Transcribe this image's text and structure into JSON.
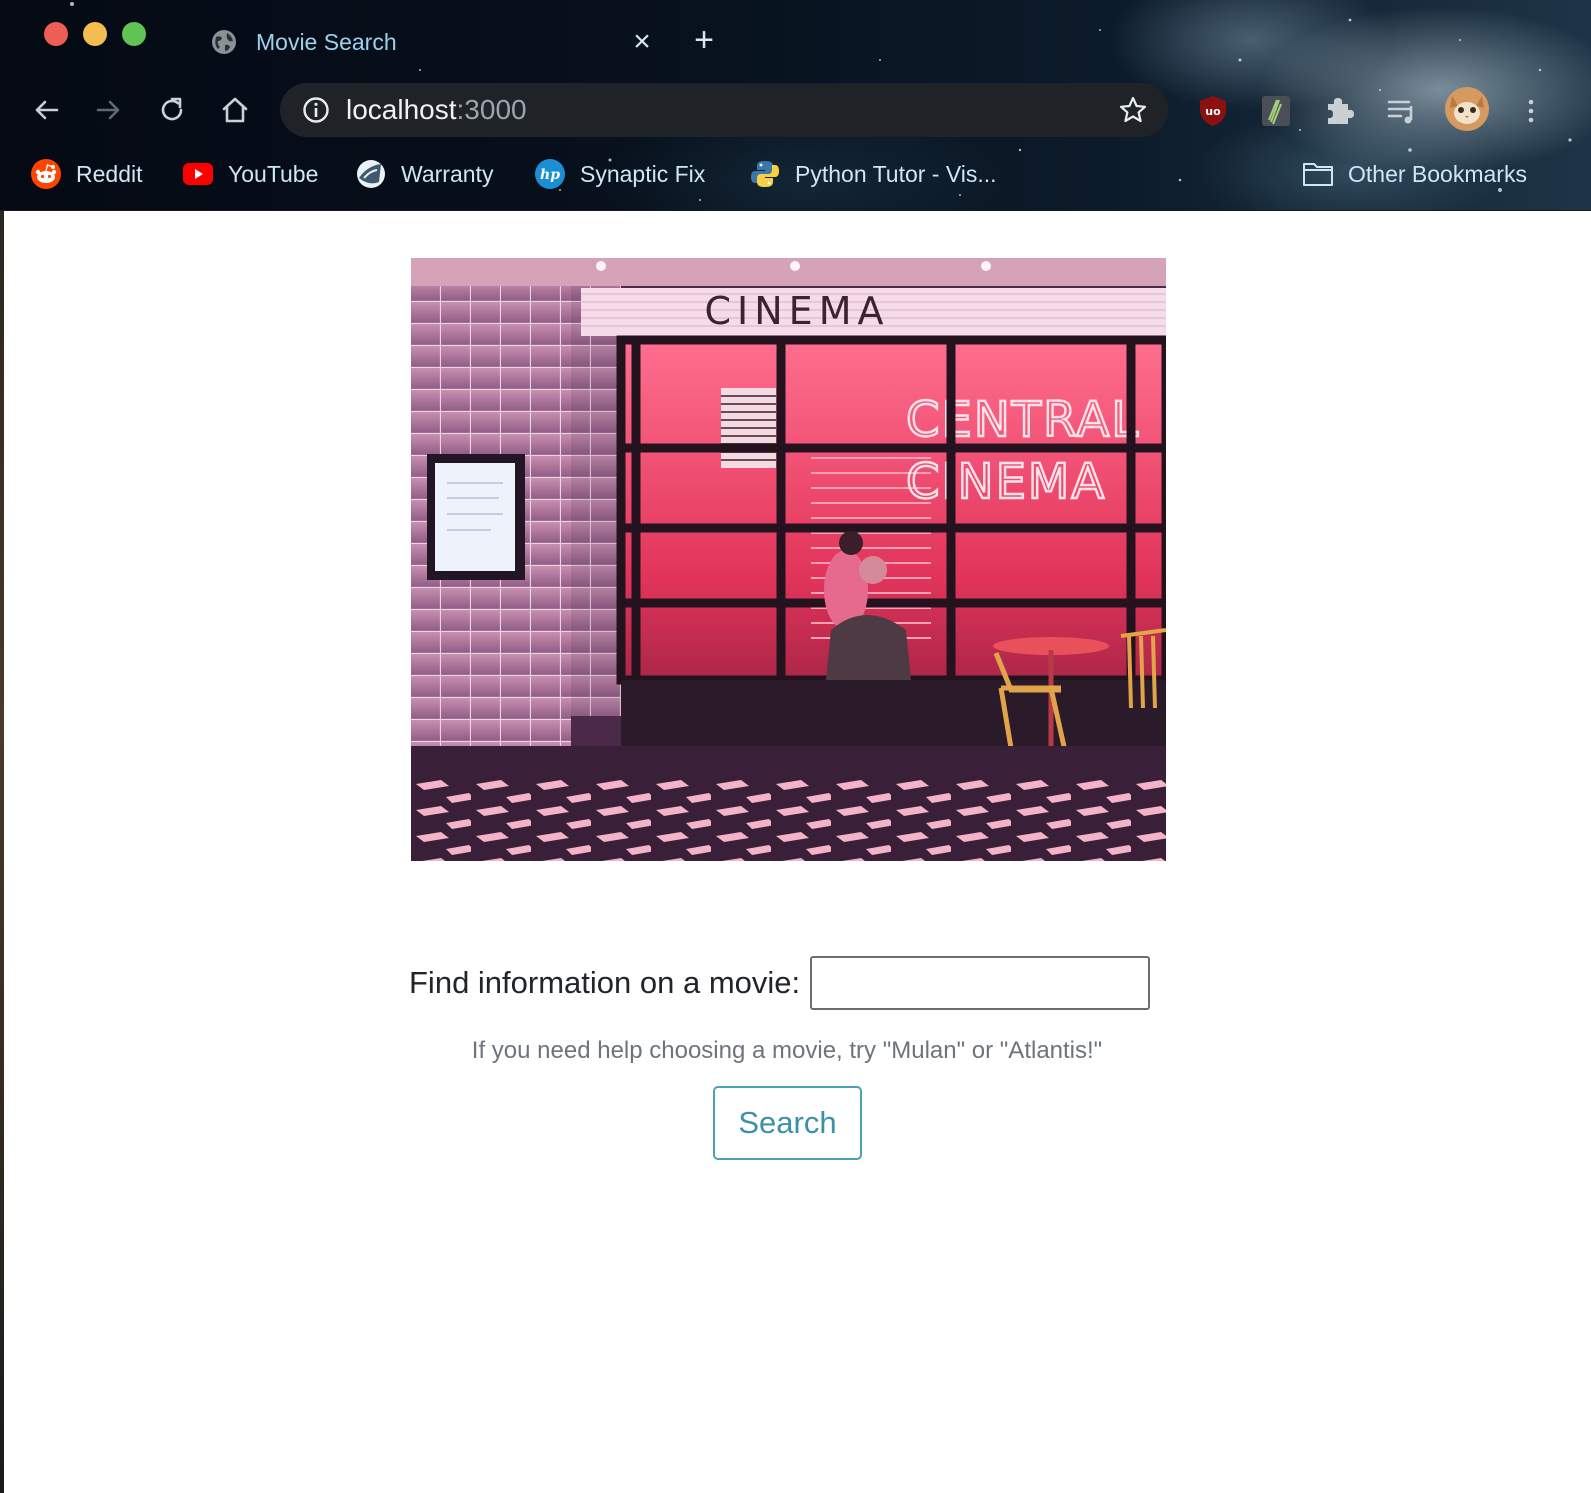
{
  "browser": {
    "tab": {
      "title": "Movie Search",
      "close_glyph": "×",
      "favicon": "globe-icon"
    },
    "new_tab_glyph": "+",
    "omnibox": {
      "host": "localhost",
      "port": ":3000"
    },
    "bookmarks": [
      {
        "label": "Reddit",
        "icon": "reddit-icon"
      },
      {
        "label": "YouTube",
        "icon": "youtube-icon"
      },
      {
        "label": "Warranty",
        "icon": "warranty-icon"
      },
      {
        "label": "Synaptic Fix",
        "icon": "hp-icon"
      },
      {
        "label": "Python Tutor - Vis...",
        "icon": "python-icon"
      }
    ],
    "other_bookmarks": "Other Bookmarks",
    "extensions": [
      "ublock-origin-icon",
      "extension-icon",
      "puzzle-piece-icon",
      "media-queue-icon",
      "profile-avatar-icon"
    ]
  },
  "hero_image": {
    "sign_top": "CINEMA",
    "neon_line_1": "CENTRAL",
    "neon_line_2": "CINEMA"
  },
  "form": {
    "label": "Find information on a movie:",
    "input_value": "",
    "help": "If you need help choosing a movie, try \"Mulan\" or \"Atlantis!\"",
    "button": "Search"
  },
  "colors": {
    "accent": "#3a91a8",
    "help_text": "#6c757d",
    "neon": "#ff3b5c"
  }
}
